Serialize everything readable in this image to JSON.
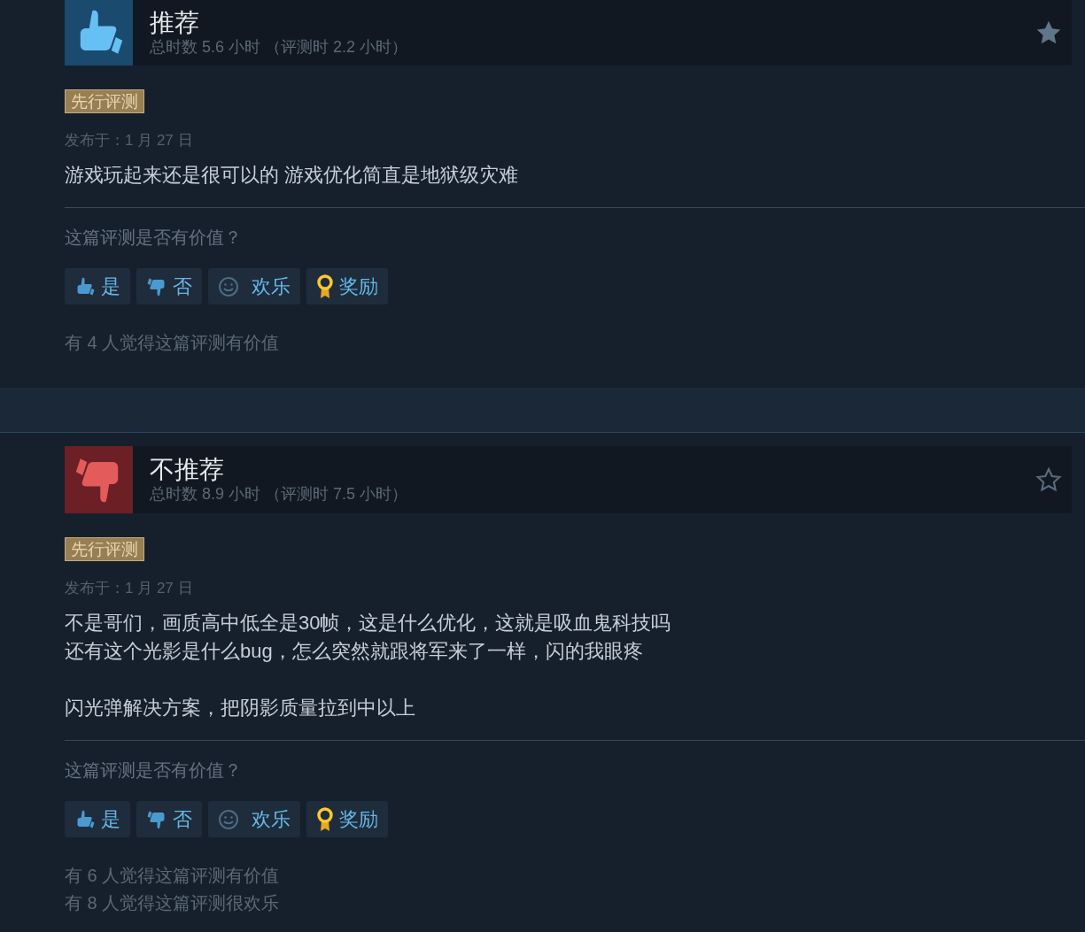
{
  "reviews": [
    {
      "kind": "recommended",
      "title": "推荐",
      "playtime": "总时数 5.6 小时 （评测时 2.2 小时）",
      "starred": true,
      "badge": "先行评测",
      "posted": "发布于：1 月 27 日",
      "paragraphs": [
        {
          "lines": [
            "游戏玩起来还是很可以的 游戏优化简直是地狱级灾难"
          ]
        }
      ],
      "prompt": "这篇评测是否有价值？",
      "buttons": [
        {
          "kind": "yes",
          "label": "是"
        },
        {
          "kind": "no",
          "label": "否"
        },
        {
          "kind": "funny",
          "label": "欢乐"
        },
        {
          "kind": "award",
          "label": "奖励"
        }
      ],
      "stats": [
        "有 4 人觉得这篇评测有价值"
      ]
    },
    {
      "kind": "not_recommended",
      "title": "不推荐",
      "playtime": "总时数 8.9 小时 （评测时 7.5 小时）",
      "starred": false,
      "badge": "先行评测",
      "posted": "发布于：1 月 27 日",
      "paragraphs": [
        {
          "lines": [
            "不是哥们，画质高中低全是30帧，这是什么优化，这就是吸血鬼科技吗",
            "还有这个光影是什么bug，怎么突然就跟将军来了一样，闪的我眼疼"
          ]
        },
        {
          "lines": [
            "闪光弹解决方案，把阴影质量拉到中以上"
          ]
        }
      ],
      "prompt": "这篇评测是否有价值？",
      "buttons": [
        {
          "kind": "yes",
          "label": "是"
        },
        {
          "kind": "no",
          "label": "否"
        },
        {
          "kind": "funny",
          "label": "欢乐"
        },
        {
          "kind": "award",
          "label": "奖励"
        }
      ],
      "stats": [
        "有 6 人觉得这篇评测有价值",
        "有 8 人觉得这篇评测很欢乐"
      ]
    }
  ]
}
